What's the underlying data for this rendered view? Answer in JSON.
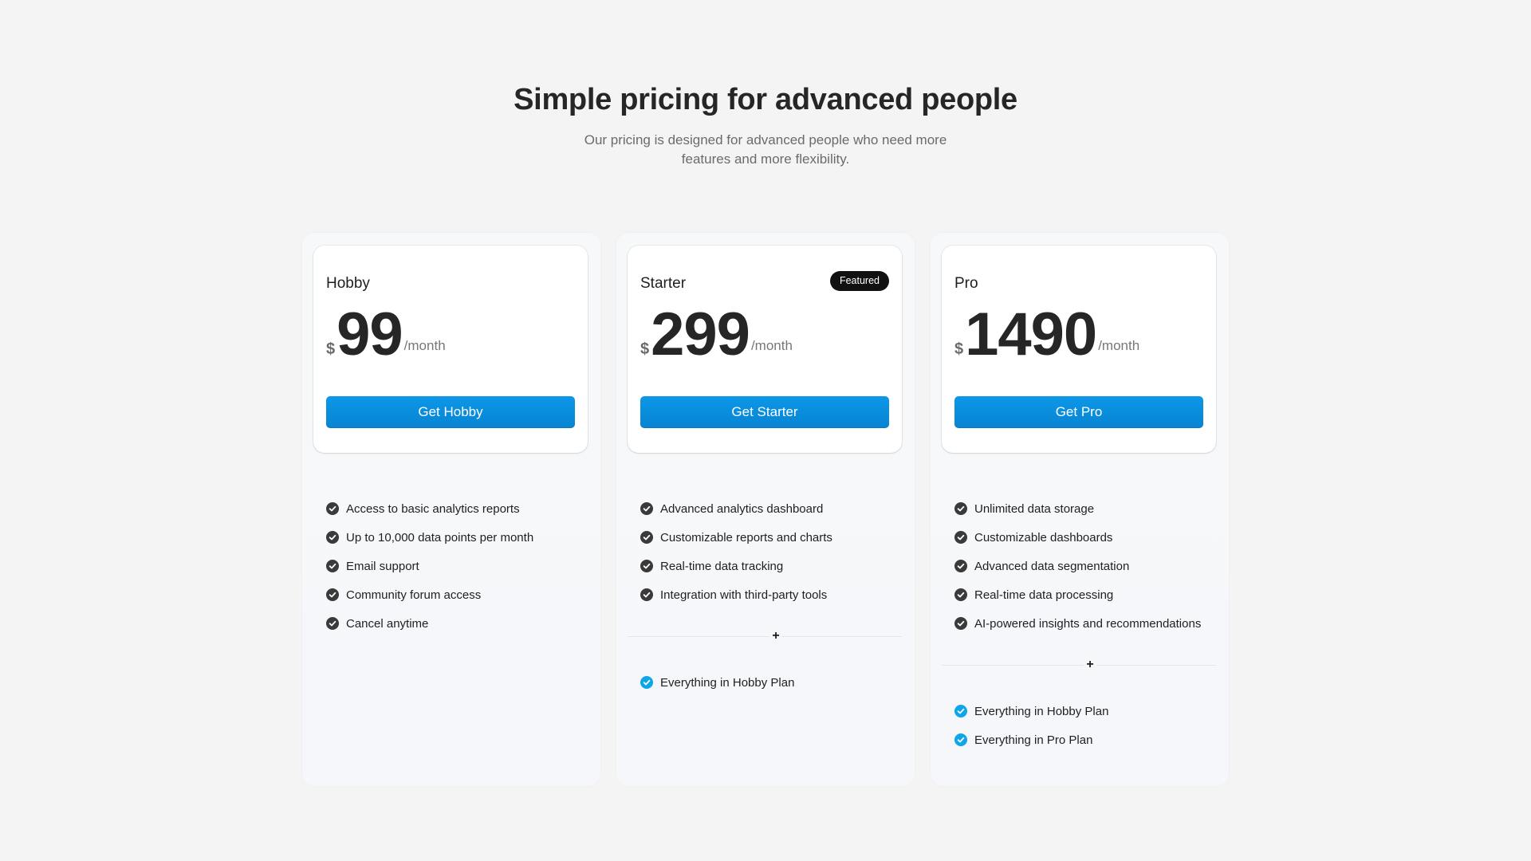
{
  "header": {
    "title": "Simple pricing for advanced people",
    "subtitle": "Our pricing is designed for advanced people who need more features and more flexibility."
  },
  "colors": {
    "accent": "#0a8fde",
    "check_dark": "#3a3a3a",
    "check_accent": "#0ea5e9",
    "badge": "#111111"
  },
  "plans": [
    {
      "name": "Hobby",
      "featured": false,
      "currency": "$",
      "price": "99",
      "period": "/month",
      "cta_label": "Get Hobby",
      "features": [
        "Access to basic analytics reports",
        "Up to 10,000 data points per month",
        "Email support",
        "Community forum access",
        "Cancel anytime"
      ],
      "extras": []
    },
    {
      "name": "Starter",
      "featured": true,
      "badge_label": "Featured",
      "currency": "$",
      "price": "299",
      "period": "/month",
      "cta_label": "Get Starter",
      "features": [
        "Advanced analytics dashboard",
        "Customizable reports and charts",
        "Real-time data tracking",
        "Integration with third-party tools"
      ],
      "divider_symbol": "+",
      "extras": [
        "Everything in Hobby Plan"
      ]
    },
    {
      "name": "Pro",
      "featured": false,
      "currency": "$",
      "price": "1490",
      "period": "/month",
      "cta_label": "Get Pro",
      "features": [
        "Unlimited data storage",
        "Customizable dashboards",
        "Advanced data segmentation",
        "Real-time data processing",
        "AI-powered insights and recommendations"
      ],
      "divider_symbol": "+",
      "extras": [
        "Everything in Hobby Plan",
        "Everything in Pro Plan"
      ]
    }
  ]
}
